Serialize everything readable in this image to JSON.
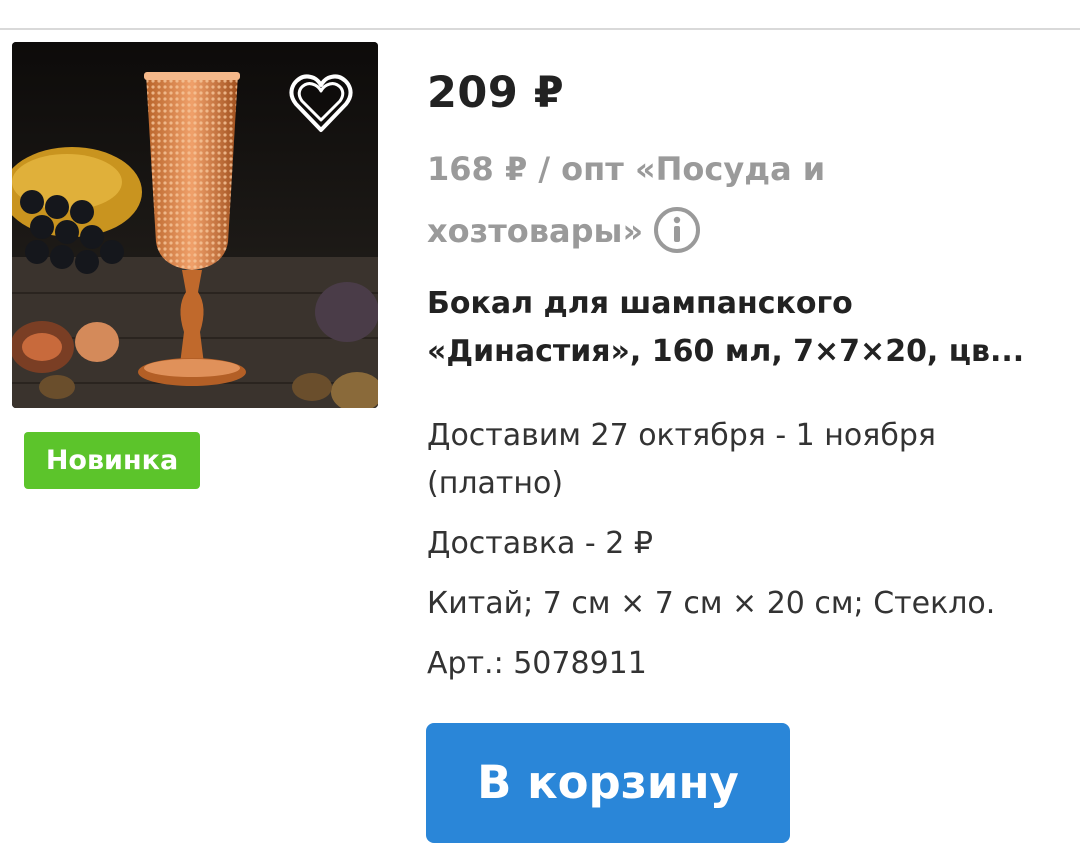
{
  "product": {
    "price": "209 ₽",
    "wholesale": "168 ₽ / опт «Посуда и хозтовары»",
    "title": "Бокал для шампанского «Династия», 160 мл, 7×7×20, цв...",
    "delivery_dates": "Доставим 27 октября - 1 ноября (платно)",
    "delivery_cost": "Доставка - 2 ₽",
    "spec": "Китай; 7 см × 7 см × 20 см; Стекло.",
    "sku": "Арт.: 5078911",
    "badge": "Новинка",
    "add_to_cart": "В корзину"
  },
  "icons": {
    "favorite": "heart-icon",
    "info": "info-circle-icon"
  },
  "colors": {
    "accent": "#2a86d8",
    "badge": "#5cc42b",
    "muted_text": "#9a9a9a"
  }
}
